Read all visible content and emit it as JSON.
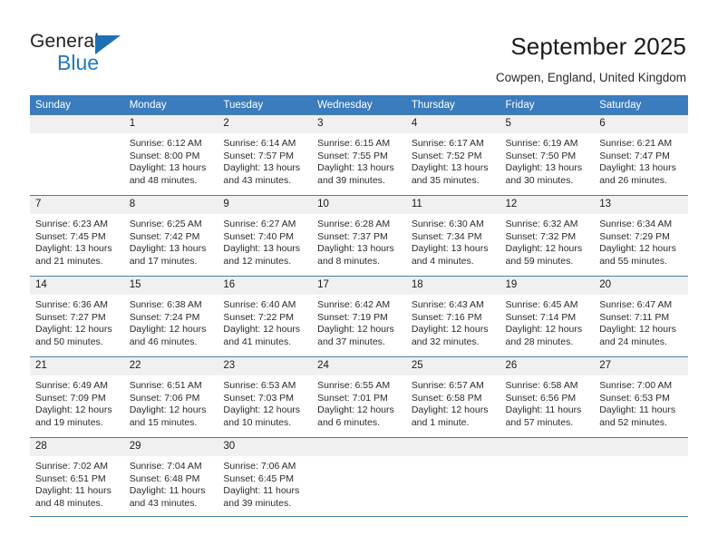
{
  "brand": {
    "name_part1": "General",
    "name_part2": "Blue",
    "triangle_icon": "triangle-icon",
    "accent_color": "#1f7ac0"
  },
  "header": {
    "title": "September 2025",
    "subtitle": "Cowpen, England, United Kingdom"
  },
  "colors": {
    "header_blue": "#3a7cbe",
    "daynum_gray": "#f0f0f0",
    "grid_line": "#4a7ea8"
  },
  "calendar": {
    "weekday_headers": [
      "Sunday",
      "Monday",
      "Tuesday",
      "Wednesday",
      "Thursday",
      "Friday",
      "Saturday"
    ],
    "weeks": [
      [
        {
          "day": "",
          "blank": true,
          "sunrise": "",
          "sunset": "",
          "daylight_line1": "",
          "daylight_line2": ""
        },
        {
          "day": "1",
          "sunrise": "Sunrise: 6:12 AM",
          "sunset": "Sunset: 8:00 PM",
          "daylight_line1": "Daylight: 13 hours",
          "daylight_line2": "and 48 minutes."
        },
        {
          "day": "2",
          "sunrise": "Sunrise: 6:14 AM",
          "sunset": "Sunset: 7:57 PM",
          "daylight_line1": "Daylight: 13 hours",
          "daylight_line2": "and 43 minutes."
        },
        {
          "day": "3",
          "sunrise": "Sunrise: 6:15 AM",
          "sunset": "Sunset: 7:55 PM",
          "daylight_line1": "Daylight: 13 hours",
          "daylight_line2": "and 39 minutes."
        },
        {
          "day": "4",
          "sunrise": "Sunrise: 6:17 AM",
          "sunset": "Sunset: 7:52 PM",
          "daylight_line1": "Daylight: 13 hours",
          "daylight_line2": "and 35 minutes."
        },
        {
          "day": "5",
          "sunrise": "Sunrise: 6:19 AM",
          "sunset": "Sunset: 7:50 PM",
          "daylight_line1": "Daylight: 13 hours",
          "daylight_line2": "and 30 minutes."
        },
        {
          "day": "6",
          "sunrise": "Sunrise: 6:21 AM",
          "sunset": "Sunset: 7:47 PM",
          "daylight_line1": "Daylight: 13 hours",
          "daylight_line2": "and 26 minutes."
        }
      ],
      [
        {
          "day": "7",
          "sunrise": "Sunrise: 6:23 AM",
          "sunset": "Sunset: 7:45 PM",
          "daylight_line1": "Daylight: 13 hours",
          "daylight_line2": "and 21 minutes."
        },
        {
          "day": "8",
          "sunrise": "Sunrise: 6:25 AM",
          "sunset": "Sunset: 7:42 PM",
          "daylight_line1": "Daylight: 13 hours",
          "daylight_line2": "and 17 minutes."
        },
        {
          "day": "9",
          "sunrise": "Sunrise: 6:27 AM",
          "sunset": "Sunset: 7:40 PM",
          "daylight_line1": "Daylight: 13 hours",
          "daylight_line2": "and 12 minutes."
        },
        {
          "day": "10",
          "sunrise": "Sunrise: 6:28 AM",
          "sunset": "Sunset: 7:37 PM",
          "daylight_line1": "Daylight: 13 hours",
          "daylight_line2": "and 8 minutes."
        },
        {
          "day": "11",
          "sunrise": "Sunrise: 6:30 AM",
          "sunset": "Sunset: 7:34 PM",
          "daylight_line1": "Daylight: 13 hours",
          "daylight_line2": "and 4 minutes."
        },
        {
          "day": "12",
          "sunrise": "Sunrise: 6:32 AM",
          "sunset": "Sunset: 7:32 PM",
          "daylight_line1": "Daylight: 12 hours",
          "daylight_line2": "and 59 minutes."
        },
        {
          "day": "13",
          "sunrise": "Sunrise: 6:34 AM",
          "sunset": "Sunset: 7:29 PM",
          "daylight_line1": "Daylight: 12 hours",
          "daylight_line2": "and 55 minutes."
        }
      ],
      [
        {
          "day": "14",
          "sunrise": "Sunrise: 6:36 AM",
          "sunset": "Sunset: 7:27 PM",
          "daylight_line1": "Daylight: 12 hours",
          "daylight_line2": "and 50 minutes."
        },
        {
          "day": "15",
          "sunrise": "Sunrise: 6:38 AM",
          "sunset": "Sunset: 7:24 PM",
          "daylight_line1": "Daylight: 12 hours",
          "daylight_line2": "and 46 minutes."
        },
        {
          "day": "16",
          "sunrise": "Sunrise: 6:40 AM",
          "sunset": "Sunset: 7:22 PM",
          "daylight_line1": "Daylight: 12 hours",
          "daylight_line2": "and 41 minutes."
        },
        {
          "day": "17",
          "sunrise": "Sunrise: 6:42 AM",
          "sunset": "Sunset: 7:19 PM",
          "daylight_line1": "Daylight: 12 hours",
          "daylight_line2": "and 37 minutes."
        },
        {
          "day": "18",
          "sunrise": "Sunrise: 6:43 AM",
          "sunset": "Sunset: 7:16 PM",
          "daylight_line1": "Daylight: 12 hours",
          "daylight_line2": "and 32 minutes."
        },
        {
          "day": "19",
          "sunrise": "Sunrise: 6:45 AM",
          "sunset": "Sunset: 7:14 PM",
          "daylight_line1": "Daylight: 12 hours",
          "daylight_line2": "and 28 minutes."
        },
        {
          "day": "20",
          "sunrise": "Sunrise: 6:47 AM",
          "sunset": "Sunset: 7:11 PM",
          "daylight_line1": "Daylight: 12 hours",
          "daylight_line2": "and 24 minutes."
        }
      ],
      [
        {
          "day": "21",
          "sunrise": "Sunrise: 6:49 AM",
          "sunset": "Sunset: 7:09 PM",
          "daylight_line1": "Daylight: 12 hours",
          "daylight_line2": "and 19 minutes."
        },
        {
          "day": "22",
          "sunrise": "Sunrise: 6:51 AM",
          "sunset": "Sunset: 7:06 PM",
          "daylight_line1": "Daylight: 12 hours",
          "daylight_line2": "and 15 minutes."
        },
        {
          "day": "23",
          "sunrise": "Sunrise: 6:53 AM",
          "sunset": "Sunset: 7:03 PM",
          "daylight_line1": "Daylight: 12 hours",
          "daylight_line2": "and 10 minutes."
        },
        {
          "day": "24",
          "sunrise": "Sunrise: 6:55 AM",
          "sunset": "Sunset: 7:01 PM",
          "daylight_line1": "Daylight: 12 hours",
          "daylight_line2": "and 6 minutes."
        },
        {
          "day": "25",
          "sunrise": "Sunrise: 6:57 AM",
          "sunset": "Sunset: 6:58 PM",
          "daylight_line1": "Daylight: 12 hours",
          "daylight_line2": "and 1 minute."
        },
        {
          "day": "26",
          "sunrise": "Sunrise: 6:58 AM",
          "sunset": "Sunset: 6:56 PM",
          "daylight_line1": "Daylight: 11 hours",
          "daylight_line2": "and 57 minutes."
        },
        {
          "day": "27",
          "sunrise": "Sunrise: 7:00 AM",
          "sunset": "Sunset: 6:53 PM",
          "daylight_line1": "Daylight: 11 hours",
          "daylight_line2": "and 52 minutes."
        }
      ],
      [
        {
          "day": "28",
          "sunrise": "Sunrise: 7:02 AM",
          "sunset": "Sunset: 6:51 PM",
          "daylight_line1": "Daylight: 11 hours",
          "daylight_line2": "and 48 minutes."
        },
        {
          "day": "29",
          "sunrise": "Sunrise: 7:04 AM",
          "sunset": "Sunset: 6:48 PM",
          "daylight_line1": "Daylight: 11 hours",
          "daylight_line2": "and 43 minutes."
        },
        {
          "day": "30",
          "sunrise": "Sunrise: 7:06 AM",
          "sunset": "Sunset: 6:45 PM",
          "daylight_line1": "Daylight: 11 hours",
          "daylight_line2": "and 39 minutes."
        },
        {
          "day": "",
          "blank": true,
          "sunrise": "",
          "sunset": "",
          "daylight_line1": "",
          "daylight_line2": ""
        },
        {
          "day": "",
          "blank": true,
          "sunrise": "",
          "sunset": "",
          "daylight_line1": "",
          "daylight_line2": ""
        },
        {
          "day": "",
          "blank": true,
          "sunrise": "",
          "sunset": "",
          "daylight_line1": "",
          "daylight_line2": ""
        },
        {
          "day": "",
          "blank": true,
          "sunrise": "",
          "sunset": "",
          "daylight_line1": "",
          "daylight_line2": ""
        }
      ]
    ]
  }
}
